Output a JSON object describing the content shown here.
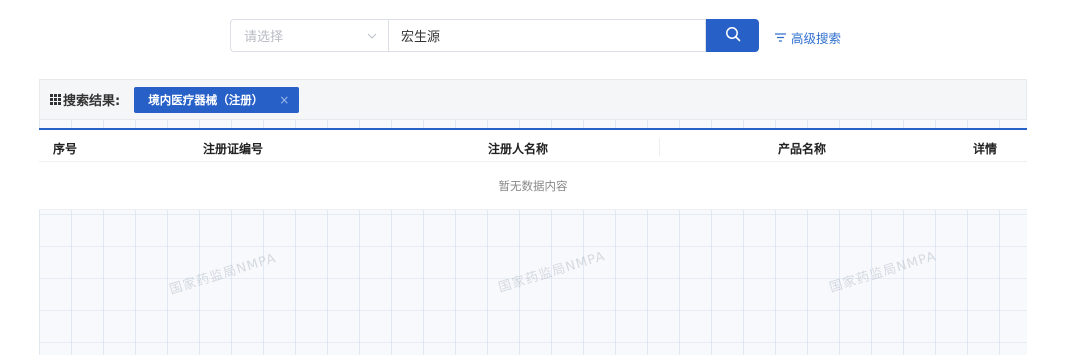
{
  "search": {
    "select_placeholder": "请选择",
    "keyword_value": "宏生源",
    "advanced_label": "高级搜索"
  },
  "results": {
    "label": "搜索结果:",
    "tag_label": "境内医疗器械（注册）",
    "tag_close": "×"
  },
  "table": {
    "columns": [
      "序号",
      "注册证编号",
      "注册人名称",
      "产品名称",
      "详情"
    ],
    "empty_text": "暂无数据内容"
  },
  "watermark_text": "国家药监局NMPA",
  "colors": {
    "accent": "#2761c8",
    "link": "#2f6fcf"
  }
}
